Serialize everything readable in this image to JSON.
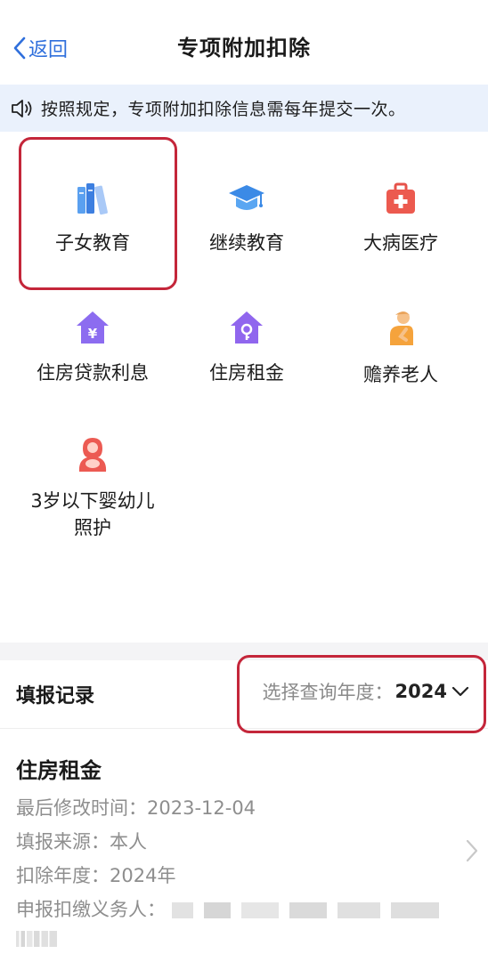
{
  "nav": {
    "back_label": "返回",
    "title": "专项附加扣除"
  },
  "notice": {
    "text": "按照规定，专项附加扣除信息需每年提交一次。"
  },
  "categories": [
    {
      "label": "子女教育",
      "icon": "books-icon"
    },
    {
      "label": "继续教育",
      "icon": "graduation-cap-icon"
    },
    {
      "label": "大病医疗",
      "icon": "medical-kit-icon"
    },
    {
      "label": "住房贷款利息",
      "icon": "house-yuan-icon"
    },
    {
      "label": "住房租金",
      "icon": "house-key-icon"
    },
    {
      "label": "赡养老人",
      "icon": "elderly-person-icon"
    },
    {
      "label": "3岁以下婴幼儿照护",
      "icon": "mother-baby-icon"
    }
  ],
  "records": {
    "title": "填报记录",
    "year_label": "选择查询年度：",
    "year_value": "2024"
  },
  "record_card": {
    "title": "住房租金",
    "modified": "最后修改时间：2023-12-04",
    "source": "填报来源：本人",
    "year": "扣除年度：2024年",
    "withholder_label": "申报扣缴义务人："
  },
  "colors": {
    "accent": "#2f6fdc",
    "highlight": "#c4263a",
    "notice_bg": "#eaf1fc"
  }
}
